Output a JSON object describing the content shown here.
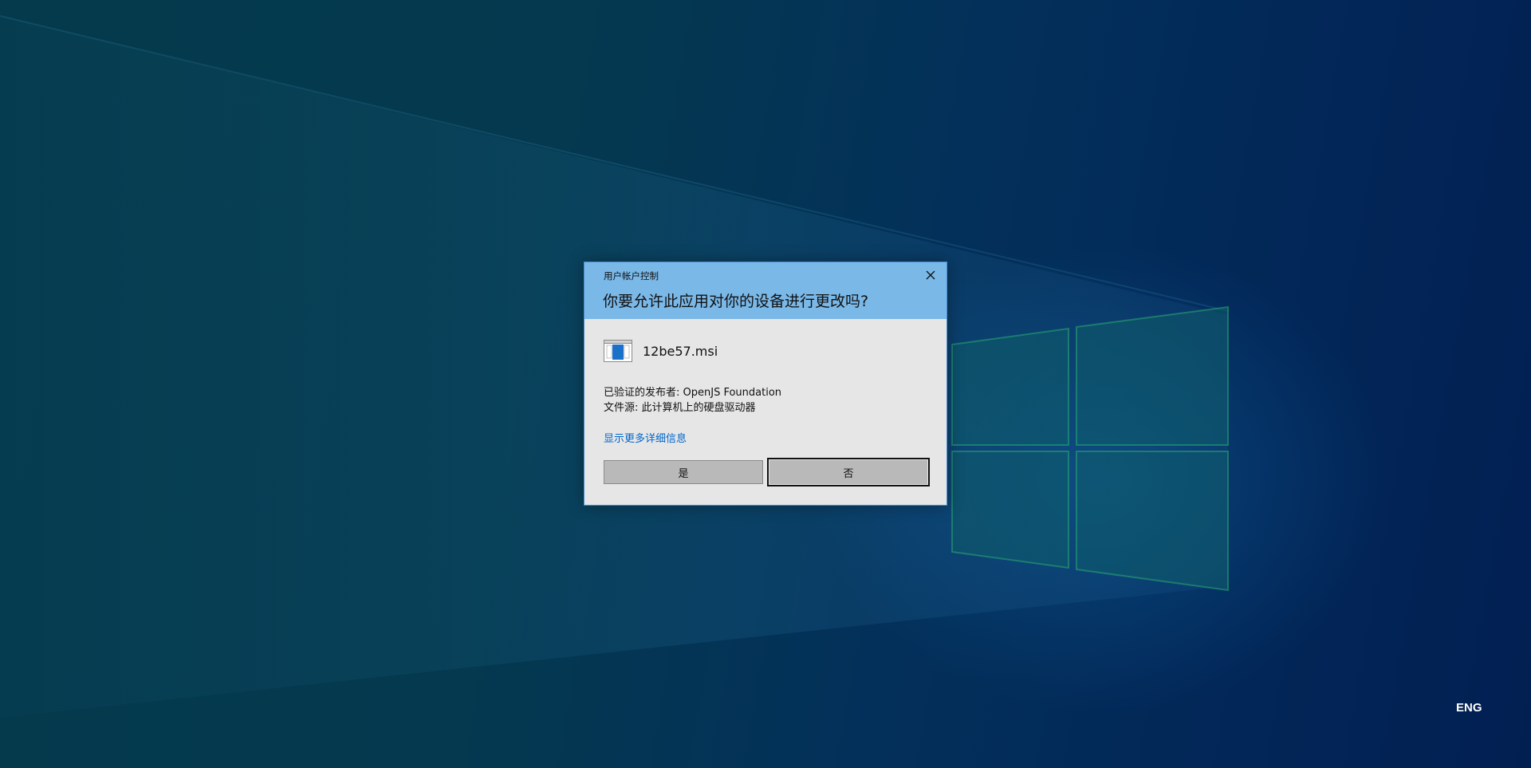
{
  "uac": {
    "caption": "用户帐户控制",
    "question": "你要允许此应用对你的设备进行更改吗?",
    "app_name": "12be57.msi",
    "publisher_line": "已验证的发布者: OpenJS Foundation",
    "origin_line": "文件源: 此计算机上的硬盘驱动器",
    "details_link": "显示更多详细信息",
    "yes_label": "是",
    "no_label": "否"
  },
  "taskbar": {
    "language": "ENG"
  },
  "colors": {
    "dialog_header": "#7ab8e8",
    "dialog_body": "#e6e6e6",
    "link": "#0066cc",
    "button": "#b9b9b9"
  },
  "icons": {
    "close": "close-icon",
    "app": "msi-installer-icon",
    "wallpaper_logo": "windows-logo"
  }
}
